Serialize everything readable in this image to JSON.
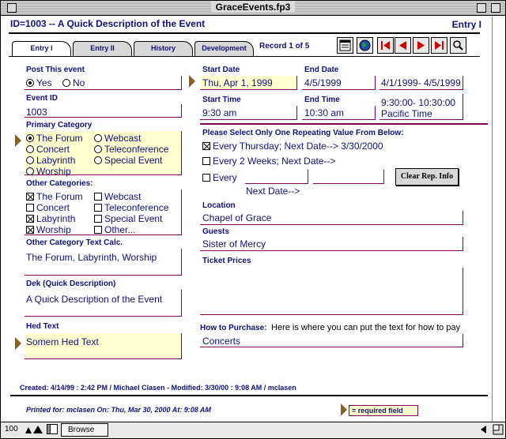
{
  "window": {
    "title": "GraceEvents.fp3"
  },
  "header": {
    "id_line": "ID=1003 -- A Quick Description of the Event",
    "entry": "Entry I"
  },
  "tabs": [
    {
      "label": "Entry I"
    },
    {
      "label": "Entry II"
    },
    {
      "label": "History"
    },
    {
      "label": "Development"
    }
  ],
  "record": "Record 1 of 5",
  "post": {
    "label": "Post This event",
    "yes": "Yes",
    "no": "No",
    "selected": "Yes"
  },
  "event_id": {
    "label": "Event ID",
    "value": "1003"
  },
  "primary": {
    "label": "Primary Category",
    "options": [
      "The Forum",
      "Webcast",
      "Concert",
      "Teleconference",
      "Labyrinth",
      "Special Event",
      "Worship"
    ],
    "selected": "The Forum"
  },
  "other": {
    "label": "Other Categories:",
    "options": [
      "The Forum",
      "Webcast",
      "Concert",
      "Teleconference",
      "Labyrinth",
      "Special Event",
      "Worship",
      "Other..."
    ],
    "checked": [
      "The Forum",
      "Labyrinth",
      "Worship"
    ]
  },
  "other_calc": {
    "label": "Other Category Text Calc.",
    "value": "The Forum, Labyrinth, Worship"
  },
  "dek": {
    "label": "Dek  (Quick Description)",
    "value": "A Quick Description of the Event"
  },
  "hed": {
    "label": "Hed Text",
    "value": "Somem Hed Text"
  },
  "start_date": {
    "label": "Start Date",
    "value": "Thu, Apr 1, 1999"
  },
  "end_date": {
    "label": "End Date",
    "value": "4/5/1999"
  },
  "date_range": "4/1/1999- 4/5/1999",
  "start_time": {
    "label": "Start Time",
    "value": "9:30 am"
  },
  "end_time": {
    "label": "End Time",
    "value": "10:30 am"
  },
  "time_range": {
    "line1": "9:30:00- 10:30:00",
    "line2": "Pacific Time"
  },
  "repeat": {
    "label": "Please Select Only One Repeating Value From Below:",
    "opt1": "Every Thursday;  Next Date--> 3/30/2000",
    "opt2": "Every 2  Weeks;  Next Date-->",
    "opt3": "Every",
    "next_date": "Next Date-->",
    "clear_btn": "Clear Rep. Info"
  },
  "location": {
    "label": "Location",
    "value": "Chapel of Grace"
  },
  "guests": {
    "label": "Guests",
    "value": "Sister of Mercy"
  },
  "tickets": {
    "label": "Ticket Prices",
    "value": ""
  },
  "purchase": {
    "label": "How to Purchase:",
    "hint": "Here is where you can put the text for how to pay",
    "value": "Concerts"
  },
  "footer": {
    "created": "Created: 4/14/99 : 2:42 PM / Michael Clasen - Modified: 3/30/00 : 9:08 AM / mclasen",
    "printed": "Printed for:  mclasen   On:  Thu, Mar 30, 2000    At:  9:08 AM",
    "required": "= required field"
  },
  "status": {
    "zoom": "100",
    "mode": "Browse"
  },
  "colors": {
    "label": "#10107a",
    "field_border": "#800060",
    "required_bg": "#ffffd0",
    "arrow": "#8a6020",
    "nav_red": "#cc0000"
  }
}
